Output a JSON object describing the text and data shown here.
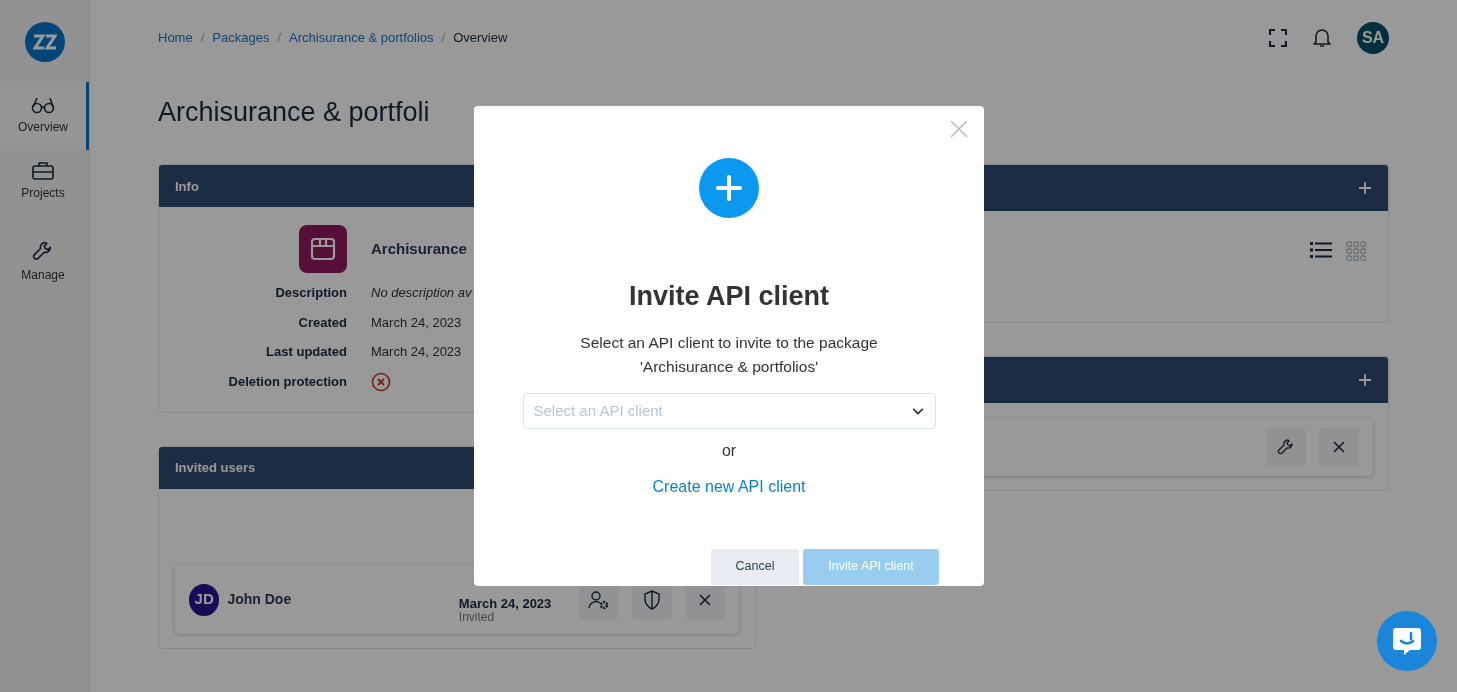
{
  "sidebar": {
    "items": [
      {
        "label": "Overview",
        "selected": true
      },
      {
        "label": "Projects",
        "selected": false
      },
      {
        "label": "Manage",
        "selected": false
      }
    ]
  },
  "breadcrumb": [
    {
      "label": "Home",
      "current": false
    },
    {
      "separator": "/",
      "label": "Packages",
      "current": false
    },
    {
      "separator": "/",
      "label": "Archisurance & portfolios",
      "current": false
    },
    {
      "separator": "/",
      "label": "Overview",
      "current": true
    }
  ],
  "header": {
    "avatar_initials": "SA"
  },
  "page_title": "Archisurance & portfoli",
  "info_card": {
    "title": "Info",
    "name": "Archisurance",
    "fields": [
      {
        "label": "Description",
        "kind": "italic",
        "value": "No description av"
      },
      {
        "label": "Created",
        "kind": "text",
        "value": "March 24, 2023"
      },
      {
        "label": "Last updated",
        "kind": "text",
        "value": "March 24, 2023"
      },
      {
        "label": "Deletion protection",
        "kind": "status",
        "on": false
      }
    ]
  },
  "invited_users": {
    "title": "Invited users",
    "users": [
      {
        "initials": "JD",
        "name": "John Doe",
        "date": "March 24, 2023",
        "status": "Invited"
      }
    ]
  },
  "view_toggle": [
    {
      "selected": true
    },
    {
      "selected": false
    }
  ],
  "modal": {
    "title": "Invite API client",
    "message": "Select an API client to invite to the package 'Archisurance & portfolios'",
    "select": {
      "placeholder": "Select an API client"
    },
    "separator": "or",
    "link": "Create new API client",
    "buttons": [
      {
        "label": "Cancel",
        "kind": "secondary",
        "disabled": false
      },
      {
        "label": "Invite API client",
        "kind": "primary",
        "disabled": true
      }
    ]
  }
}
